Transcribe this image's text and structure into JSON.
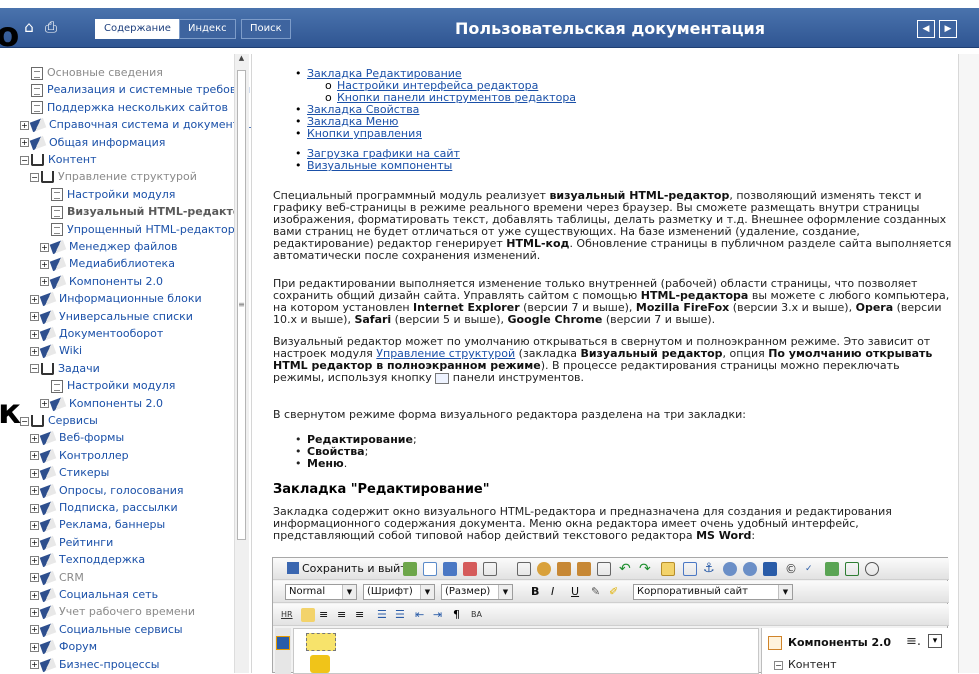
{
  "header": {
    "tabs": [
      {
        "label": "Содержание"
      },
      {
        "label": "Индекс"
      },
      {
        "label": "Поиск"
      }
    ],
    "title": "Пользовательская документация"
  },
  "overlay_chars": {
    "left_top": "о",
    "left_mid": "к"
  },
  "sidebar": {
    "items": [
      {
        "label": "Основные сведения"
      },
      {
        "label": "Реализация и системные требования"
      },
      {
        "label": "Поддержка нескольких сайтов"
      },
      {
        "label": "Справочная система и документация"
      },
      {
        "label": "Общая информация"
      },
      {
        "label": "Контент"
      },
      {
        "label": "Управление структурой"
      },
      {
        "label": "Настройки модуля"
      },
      {
        "label": "Визуальный HTML-редактор"
      },
      {
        "label": "Упрощенный HTML-редактор"
      },
      {
        "label": "Менеджер файлов"
      },
      {
        "label": "Медиабиблиотека"
      },
      {
        "label": "Компоненты 2.0"
      },
      {
        "label": "Информационные блоки"
      },
      {
        "label": "Универсальные списки"
      },
      {
        "label": "Документооборот"
      },
      {
        "label": "Wiki"
      },
      {
        "label": "Задачи"
      },
      {
        "label": "Настройки модуля"
      },
      {
        "label": "Компоненты 2.0"
      },
      {
        "label": "Сервисы"
      },
      {
        "label": "Веб-формы"
      },
      {
        "label": "Контроллер"
      },
      {
        "label": "Стикеры"
      },
      {
        "label": "Опросы, голосования"
      },
      {
        "label": "Подписка, рассылки"
      },
      {
        "label": "Реклама, баннеры"
      },
      {
        "label": "Рейтинги"
      },
      {
        "label": "Техподдержка"
      },
      {
        "label": "CRM"
      },
      {
        "label": "Социальная сеть"
      },
      {
        "label": "Учет рабочего времени"
      },
      {
        "label": "Социальные сервисы"
      },
      {
        "label": "Форум"
      },
      {
        "label": "Бизнес-процессы"
      }
    ]
  },
  "content": {
    "links": {
      "l1": "Закладка Редактирование",
      "l1a": "Настройки интерфейса редактора",
      "l1b": "Кнопки панели инструментов редактора",
      "l2": "Закладка Свойства",
      "l3": "Закладка Меню",
      "l4": "Кнопки управления",
      "l5": "Загрузка графики на сайт",
      "l6": "Визуальные компоненты"
    },
    "p1": {
      "a": "Специальный программный модуль реализует ",
      "b": "визуальный HTML-редактор",
      "c": ", позволяющий изменять текст и графику веб-страницы в режиме реального времени через браузер. Вы сможете размещать внутри страницы изображения, форматировать текст, добавлять таблицы, делать разметку и т.д. Внешнее оформление созданных вами страниц не будет отличаться от уже существующих. На базе изменений (удаление, создание, редактирование) редактор генерирует ",
      "d": "HTML-код",
      "e": ". Обновление страницы в публичном разделе сайта выполняется автоматически после сохранения изменений."
    },
    "p2": {
      "a": "При редактировании выполняется изменение только внутренней (рабочей) области страницы, что позволяет сохранить общий дизайн сайта. Управлять сайтом с помощью ",
      "b": "HTML-редактора",
      "c": " вы можете с любого компьютера, на котором установлен ",
      "d": "Internet Explorer",
      "e": " (версии 7 и выше), ",
      "f": "Mozilla FireFox",
      "g": " (версии 3.x и выше), ",
      "h": "Opera",
      "i": " (версии 10.x и выше), ",
      "j": "Safari",
      "k": " (версии 5 и выше), ",
      "l": "Google Chrome",
      "m": " (версии 7 и выше)."
    },
    "p3": {
      "a": "Визуальный редактор может по умолчанию открываться в свернутом и полноэкранном режиме. Это зависит от настроек модуля ",
      "link": "Управление структурой",
      "b": " (закладка ",
      "c": "Визуальный редактор",
      "d": ", опция ",
      "e": "По умолчанию открывать HTML редактор в полноэкранном режиме",
      "f": "). В процессе редактирования страницы можно переключать режимы, используя кнопку ",
      "g": " панели инструментов."
    },
    "p4": "В свернутом режиме форма визуального редактора разделена на три закладки:",
    "bullets": [
      "Редактирование",
      "Свойства",
      "Меню"
    ],
    "bullet_suffix": [
      ";",
      ";",
      "."
    ],
    "heading": "Закладка \"Редактирование\"",
    "p5": {
      "a": "Закладка содержит окно визуального HTML-редактора и предназначена для создания и редактирования информационного содержания документа. Меню окна редактора имеет очень удобный интерфейс, представляющий собой типовой набор действий текстового редактора ",
      "b": "MS Word",
      "c": ":"
    }
  },
  "editor": {
    "save_label": "Сохранить и выйти",
    "style_select": "Normal",
    "font_select": "(Шрифт)",
    "size_select": "(Размер)",
    "template_select": "Корпоративный сайт",
    "bold": "B",
    "italic": "I",
    "underline": "U",
    "components_title": "Компоненты 2.0",
    "components_item": "Контент"
  },
  "colors": {
    "header": "#2f5592",
    "link": "#1a50a8"
  }
}
